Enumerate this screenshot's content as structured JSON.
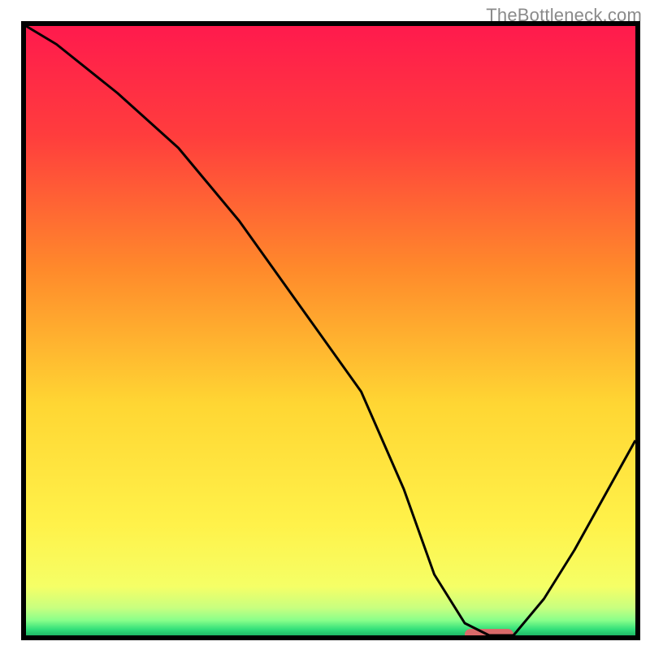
{
  "watermark": "TheBottleneck.com",
  "chart_data": {
    "type": "line",
    "title": "",
    "xlabel": "",
    "ylabel": "",
    "xlim": [
      0,
      100
    ],
    "ylim": [
      0,
      100
    ],
    "x": [
      0,
      5,
      15,
      25,
      35,
      45,
      55,
      62,
      67,
      72,
      76,
      80,
      85,
      90,
      95,
      100
    ],
    "values": [
      100,
      97,
      89,
      80,
      68,
      54,
      40,
      24,
      10,
      2,
      0,
      0,
      6,
      14,
      23,
      32
    ],
    "grid": false,
    "background": "rainbow-gradient",
    "gradient_stops": [
      {
        "pos": 0.0,
        "color": "#ff1a4d"
      },
      {
        "pos": 0.18,
        "color": "#ff3d3d"
      },
      {
        "pos": 0.4,
        "color": "#ff8a2b"
      },
      {
        "pos": 0.62,
        "color": "#ffd633"
      },
      {
        "pos": 0.82,
        "color": "#fff24a"
      },
      {
        "pos": 0.92,
        "color": "#f5ff66"
      },
      {
        "pos": 0.955,
        "color": "#c8ff80"
      },
      {
        "pos": 0.975,
        "color": "#8aff8a"
      },
      {
        "pos": 0.99,
        "color": "#33e07a"
      },
      {
        "pos": 1.0,
        "color": "#1fb866"
      }
    ],
    "marker": {
      "x_start": 72,
      "x_end": 80,
      "color": "#d96a6a"
    }
  }
}
